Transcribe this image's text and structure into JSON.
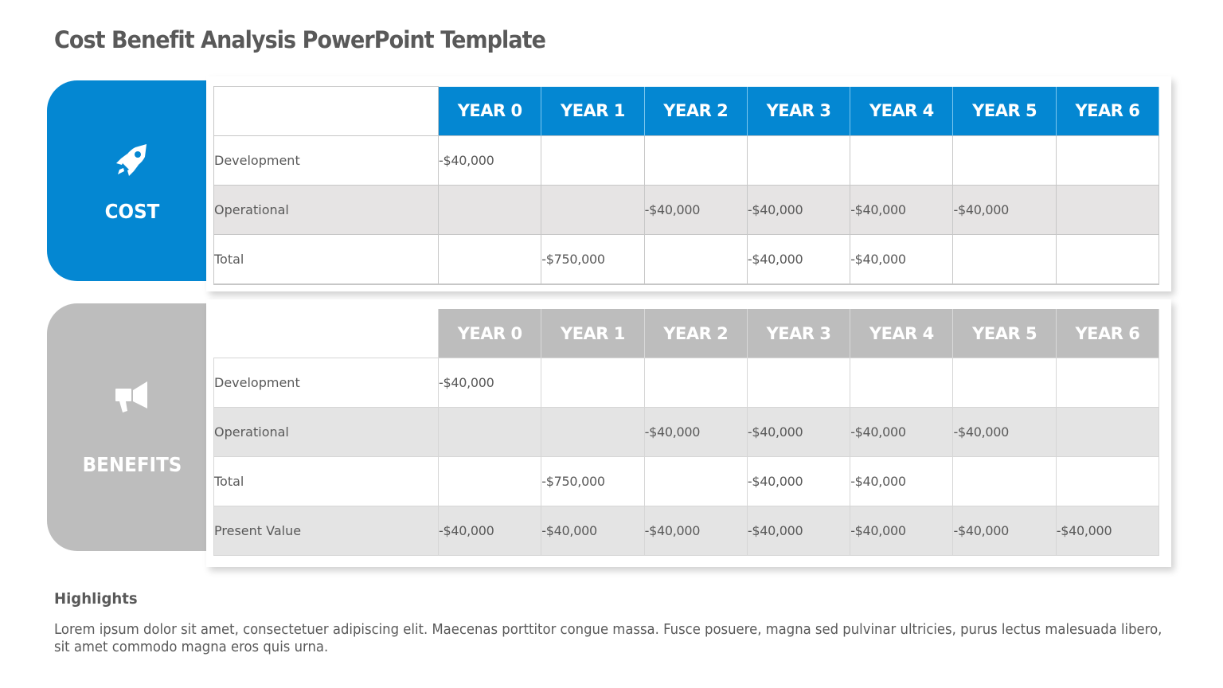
{
  "title": "Cost Benefit Analysis PowerPoint Template",
  "colors": {
    "cost_accent": "#0487d2",
    "benefits_accent": "#bdbdbd",
    "text": "#595959",
    "shaded_row": "#e6e4e4"
  },
  "cost": {
    "label": "COST",
    "icon": "rocket-icon",
    "columns": [
      "YEAR 0",
      "YEAR 1",
      "YEAR 2",
      "YEAR 3",
      "YEAR 4",
      "YEAR 5",
      "YEAR 6"
    ],
    "rows": [
      {
        "label": "Development",
        "values": [
          "-$40,000",
          "",
          "",
          "",
          "",
          "",
          ""
        ]
      },
      {
        "label": "Operational",
        "values": [
          "",
          "",
          "-$40,000",
          "-$40,000",
          "-$40,000",
          "-$40,000",
          ""
        ]
      },
      {
        "label": "Total",
        "values": [
          "",
          "-$750,000",
          "",
          "-$40,000",
          "-$40,000",
          "",
          ""
        ]
      }
    ]
  },
  "benefits": {
    "label": "BENEFITS",
    "icon": "megaphone-icon",
    "columns": [
      "YEAR 0",
      "YEAR 1",
      "YEAR 2",
      "YEAR 3",
      "YEAR 4",
      "YEAR 5",
      "YEAR 6"
    ],
    "rows": [
      {
        "label": "Development",
        "values": [
          "-$40,000",
          "",
          "",
          "",
          "",
          "",
          ""
        ]
      },
      {
        "label": "Operational",
        "values": [
          "",
          "",
          "-$40,000",
          "-$40,000",
          "-$40,000",
          "-$40,000",
          ""
        ]
      },
      {
        "label": "Total",
        "values": [
          "",
          "-$750,000",
          "",
          "-$40,000",
          "-$40,000",
          "",
          ""
        ]
      },
      {
        "label": "Present Value",
        "values": [
          "-$40,000",
          "-$40,000",
          "-$40,000",
          "-$40,000",
          "-$40,000",
          "-$40,000",
          "-$40,000"
        ]
      }
    ]
  },
  "highlights": {
    "title": "Highlights",
    "body": "Lorem ipsum dolor sit amet, consectetuer adipiscing elit. Maecenas porttitor congue massa. Fusce posuere, magna sed pulvinar ultricies, purus lectus malesuada libero, sit amet commodo magna eros quis urna."
  }
}
